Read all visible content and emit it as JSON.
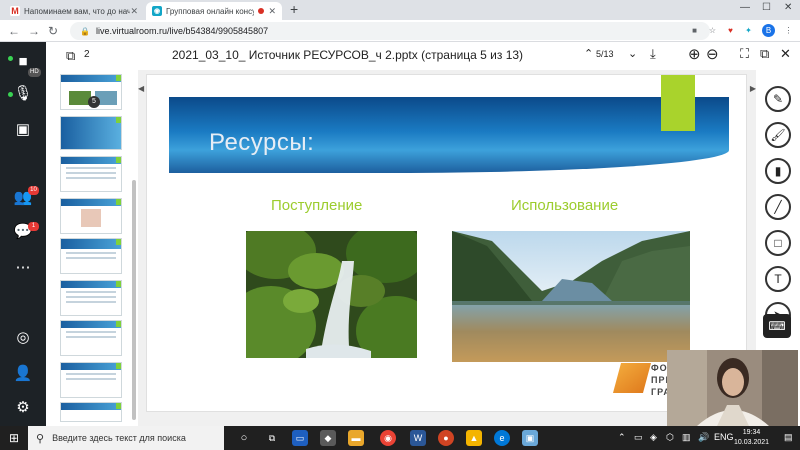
{
  "browser": {
    "tabs": [
      {
        "label": "Напоминаем вам, что до начал",
        "icon": "gmail-icon"
      },
      {
        "label": "Групповая онлайн консульт",
        "icon": "virtualroom-icon"
      }
    ],
    "url": "live.virtualroom.ru/live/b54384/9905845807",
    "profile_letter": "B"
  },
  "rail": {
    "chat_badge": "1",
    "participants_badge": "10",
    "camera_badge": "HD"
  },
  "toolbar": {
    "thumbs_count": "2",
    "document_title": "2021_03_10_ Источник РЕСУРСОВ_ч 2.pptx (страница 5 из 13)",
    "page_indicator": "5/13"
  },
  "thumbnails": {
    "current_badge": "5"
  },
  "slide": {
    "title": "Ресурсы:",
    "left_heading": "Поступление",
    "right_heading": "Использование",
    "logo_lines": [
      "ФО",
      "ПРЕ",
      "ГРА"
    ]
  },
  "taskbar": {
    "search_placeholder": "Введите здесь текст для поиска",
    "lang": "ENG",
    "time": "19:34",
    "date": "10.03.2021"
  },
  "colors": {
    "accent_green": "#a9d32c",
    "heading_green": "#9ccc2e",
    "banner_blue": "#1a7ac2"
  }
}
